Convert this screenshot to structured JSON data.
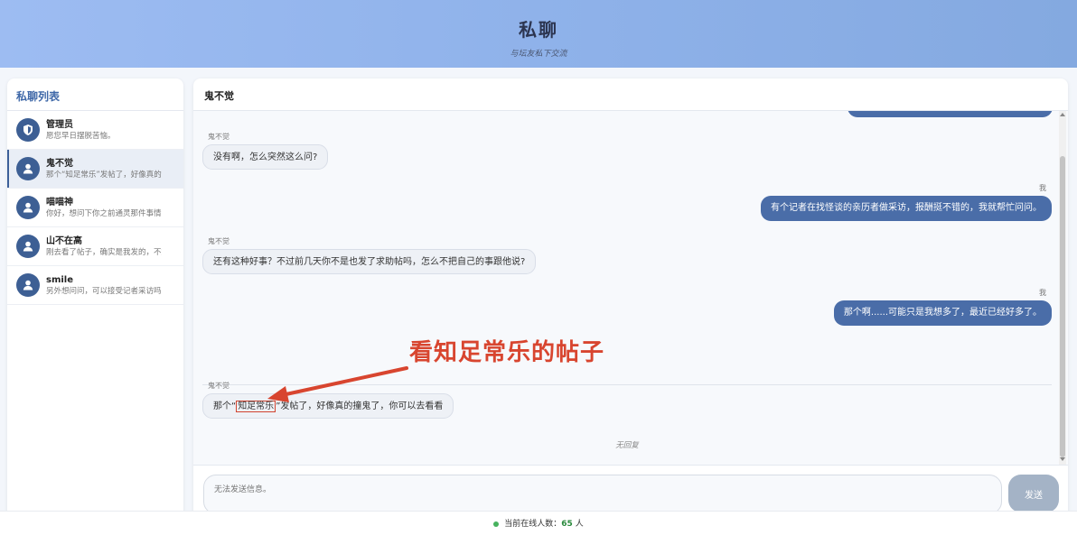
{
  "header": {
    "title": "私聊",
    "subtitle": "与坛友私下交流"
  },
  "sidebar": {
    "title": "私聊列表",
    "conversations": [
      {
        "name": "管理员",
        "preview": "愿您早日摆脱苦恼。",
        "icon": "shield-icon"
      },
      {
        "name": "鬼不觉",
        "preview": "那个“知足常乐”发帖了，好像真的撞鬼了，你可以去看看",
        "icon": "user-icon"
      },
      {
        "name": "喵喵神",
        "preview": "你好，想问下你之前通灵那件事情",
        "icon": "user-icon"
      },
      {
        "name": "山不在高",
        "preview": "刚去看了帖子，确实是我发的，不好意思",
        "icon": "user-icon"
      },
      {
        "name": "smile",
        "preview": "另外想问问，可以接受记者采访吗",
        "icon": "user-icon"
      }
    ]
  },
  "chat": {
    "contact_name": "鬼不觉",
    "messages": [
      {
        "sender": "鬼不觉",
        "text": "没有啊，怎么突然这么问?"
      },
      {
        "sender": "我",
        "text": "有个记者在找怪谈的亲历者做采访，报酬挺不错的，我就帮忙问问。"
      },
      {
        "sender": "鬼不觉",
        "text": "还有这种好事？不过前几天你不是也发了求助帖吗，怎么不把自己的事跟他说?"
      },
      {
        "sender": "我",
        "text": "那个啊......可能只是我想多了，最近已经好多了。"
      },
      {
        "sender": "鬼不觉",
        "text_before": "那个“",
        "text_highlight": "知足常乐",
        "text_after": "”发帖了，好像真的撞鬼了，你可以去看看"
      }
    ],
    "no_reply": "无回复",
    "input_placeholder": "无法发送信息。",
    "send_label": "发送"
  },
  "annotation": {
    "text": "看知足常乐的帖子",
    "color": "#d8452f"
  },
  "footer": {
    "online_label": "当前在线人数：",
    "online_count": "65",
    "online_unit": "人"
  },
  "colors": {
    "accent": "#4a6da8",
    "header_gradient_start": "#9dbcf2",
    "online_dot": "#47b25e"
  }
}
